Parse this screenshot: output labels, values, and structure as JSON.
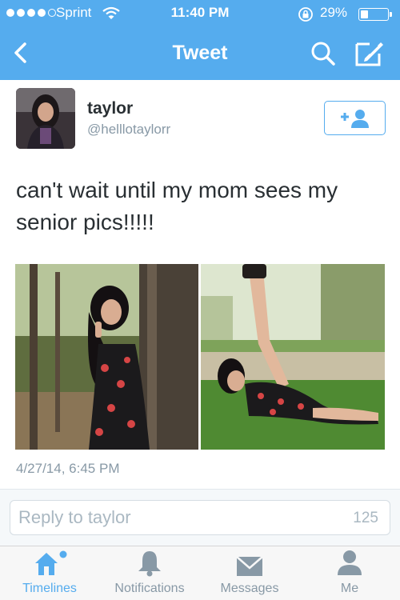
{
  "status_bar": {
    "carrier": "Sprint",
    "time": "11:40 PM",
    "battery_percent": "29%",
    "battery_level": 0.29
  },
  "nav": {
    "title": "Tweet",
    "back_icon": "chevron-left-icon",
    "search_icon": "search-icon",
    "compose_icon": "compose-icon"
  },
  "tweet": {
    "name": "taylor",
    "handle": "@helllotaylorr",
    "text": "can't wait until my mom sees my senior pics!!!!!",
    "timestamp": "4/27/14, 6:45 PM",
    "photos": [
      "photo-by-tree",
      "photo-on-grass"
    ]
  },
  "reply": {
    "placeholder": "Reply to taylor",
    "char_count": "125"
  },
  "tabs": [
    {
      "label": "Timelines",
      "icon": "home-icon",
      "active": true
    },
    {
      "label": "Notifications",
      "icon": "bell-icon",
      "active": false
    },
    {
      "label": "Messages",
      "icon": "envelope-icon",
      "active": false
    },
    {
      "label": "Me",
      "icon": "person-icon",
      "active": false
    }
  ],
  "colors": {
    "brand": "#55acee",
    "text": "#292f33",
    "secondary": "#8899a6"
  }
}
